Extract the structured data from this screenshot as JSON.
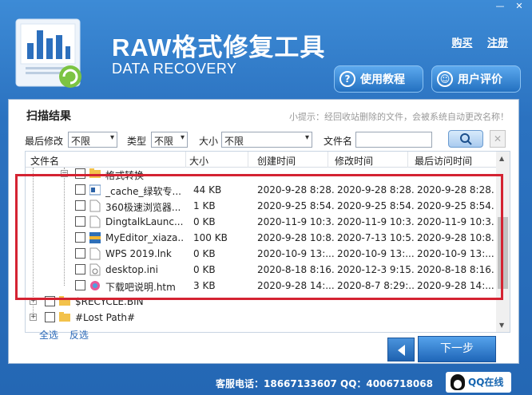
{
  "app": {
    "title": "RAW格式修复工具",
    "subtitle": "DATA RECOVERY",
    "links": {
      "buy": "购买",
      "register": "注册"
    },
    "buttons": {
      "tutorial": "使用教程",
      "review": "用户评价"
    }
  },
  "panel": {
    "title": "扫描结果",
    "tip": "小提示：经回收站删除的文件，会被系统自动更改名称！"
  },
  "filters": {
    "last_modified_label": "最后修改",
    "last_modified_value": "不限",
    "type_label": "类型",
    "type_value": "不限",
    "size_label": "大小",
    "size_value": "不限",
    "filename_label": "文件名",
    "filename_value": ""
  },
  "columns": [
    "文件名",
    "大小",
    "创建时间",
    "修改时间",
    "最后访问时间"
  ],
  "tree": {
    "parent_folder": "格式转换",
    "files": [
      {
        "name": "_cache_绿软专...",
        "size": "44 KB",
        "created": "2020-9-28 8:28...",
        "modified": "2020-9-28 8:28...",
        "accessed": "2020-9-28 8:28..."
      },
      {
        "name": "360极速浏览器...",
        "size": "1 KB",
        "created": "2020-9-25 8:54...",
        "modified": "2020-9-25 8:54...",
        "accessed": "2020-9-25 8:54..."
      },
      {
        "name": "DingtalkLaunc...",
        "size": "0 KB",
        "created": "2020-11-9 10:3...",
        "modified": "2020-11-9 10:3...",
        "accessed": "2020-11-9 10:3..."
      },
      {
        "name": "MyEditor_xiaza...",
        "size": "100 KB",
        "created": "2020-9-28 10:8...",
        "modified": "2020-7-13 10:5...",
        "accessed": "2020-9-28 10:8..."
      },
      {
        "name": "WPS 2019.lnk",
        "size": "0 KB",
        "created": "2020-10-9 13:...",
        "modified": "2020-10-9 13:...",
        "accessed": "2020-10-9 13:..."
      },
      {
        "name": "desktop.ini",
        "size": "0 KB",
        "created": "2020-8-18 8:16...",
        "modified": "2020-12-3 9:15...",
        "accessed": "2020-8-18 8:16..."
      },
      {
        "name": "下载吧说明.htm",
        "size": "3 KB",
        "created": "2020-9-28 14:...",
        "modified": "2020-8-7 8:29:...",
        "accessed": "2020-9-28 14:..."
      }
    ],
    "roots": [
      "$RECYCLE.BIN",
      "#Lost Path#"
    ]
  },
  "actions": {
    "select_all": "全选",
    "invert": "反选",
    "next": "下一步"
  },
  "footer": {
    "contact": "客服电话：18667133607  QQ：4006718068",
    "qq": "QQ在线"
  },
  "colors": {
    "header_blue": "#2b72c0",
    "highlight_red": "#d42332",
    "link_blue": "#2867b7"
  }
}
